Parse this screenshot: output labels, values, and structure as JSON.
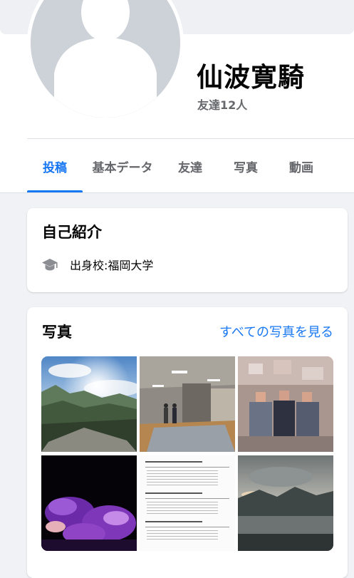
{
  "profile": {
    "name": "仙波寛騎",
    "friends_label": "友達12人"
  },
  "tabs": [
    {
      "label": "投稿",
      "active": true
    },
    {
      "label": "基本データ",
      "active": false
    },
    {
      "label": "友達",
      "active": false
    },
    {
      "label": "写真",
      "active": false
    },
    {
      "label": "動画",
      "active": false
    }
  ],
  "intro": {
    "title": "自己紹介",
    "education_prefix": "出身校: ",
    "education_school": "福岡大学",
    "icon": "graduation-cap-icon"
  },
  "photos": {
    "title": "写真",
    "see_all": "すべての写真を見る",
    "items": [
      {
        "subject": "mountain-valley-sunburst"
      },
      {
        "subject": "indoor-lobby-two-people"
      },
      {
        "subject": "group-portrait-blurred"
      },
      {
        "subject": "purple-illuminated-trees-night"
      },
      {
        "subject": "results-table-document"
      },
      {
        "subject": "cloudy-mountain-lake"
      }
    ]
  },
  "colors": {
    "accent": "#1877f2",
    "text_primary": "#050505",
    "text_secondary": "#65676b",
    "page_background": "#f0f2f5"
  }
}
